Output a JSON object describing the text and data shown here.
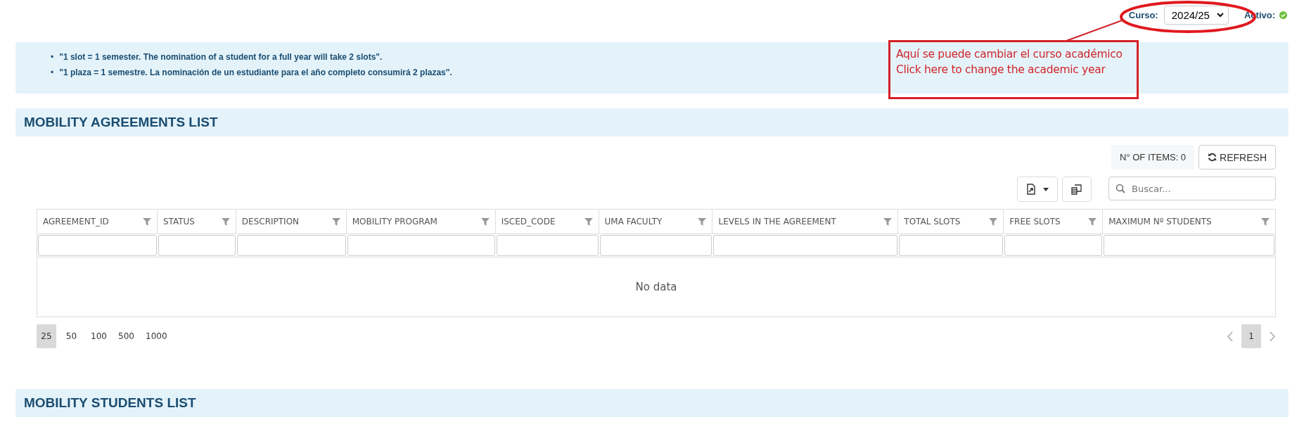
{
  "topbar": {
    "course_label": "Curso:",
    "course_value": "2024/25",
    "active_label": "Activo:",
    "active": true
  },
  "notice": {
    "items": [
      {
        "marker": "•",
        "text": "\"1 slot = 1 semester. The nomination of a student for a full year will take 2 slots\"."
      },
      {
        "marker": "•",
        "text": "\"1 plaza = 1 semestre. La nominación de un estudiante para el año completo consumirá 2 plazas\"."
      }
    ]
  },
  "annotation": {
    "lines": [
      "Aquí se puede cambiar el curso académico",
      "Click here to change the academic year"
    ]
  },
  "agreements": {
    "title": "MOBILITY AGREEMENTS LIST",
    "count": "N° OF ITEMS: 0",
    "refresh": "REFRESH",
    "search": {
      "placeholder": "Buscar..."
    },
    "columns": [
      "AGREEMENT_ID",
      "STATUS",
      "DESCRIPTION",
      "MOBILITY PROGRAM",
      "ISCED_CODE",
      "UMA FACULTY",
      "LEVELS IN THE AGREEMENT",
      "TOTAL SLOTS",
      "FREE SLOTS",
      "MAXIMUM Nº STUDENTS"
    ],
    "empty": "No data",
    "page_sizes": [
      {
        "label": "25",
        "selected": true
      },
      {
        "label": "50",
        "selected": false
      },
      {
        "label": "100",
        "selected": false
      },
      {
        "label": "500",
        "selected": false
      },
      {
        "label": "1000",
        "selected": false
      }
    ],
    "pages": [
      {
        "label": "1",
        "selected": true
      }
    ]
  },
  "students": {
    "title": "MOBILITY STUDENTS LIST"
  }
}
